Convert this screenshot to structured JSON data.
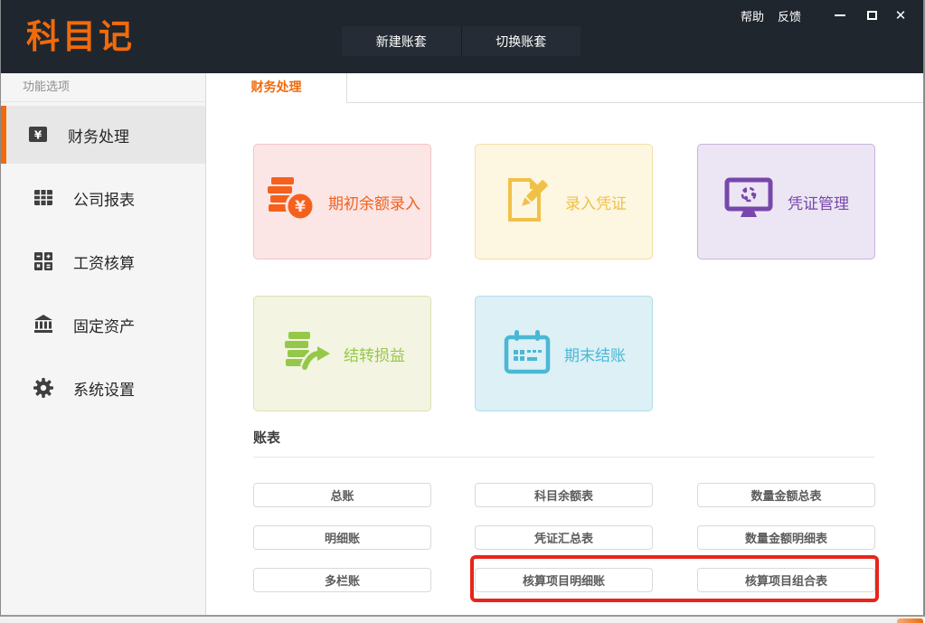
{
  "window": {
    "logo": "科目记",
    "help_label": "帮助",
    "feedback_label": "反馈"
  },
  "header": {
    "new_account_set_label": "新建账套",
    "switch_account_set_label": "切换账套"
  },
  "sidebar": {
    "title": "功能选项",
    "items": [
      {
        "label": "财务处理",
        "icon": "yuan-box-icon",
        "selected": true
      },
      {
        "label": "公司报表",
        "icon": "report-grid-icon",
        "selected": false
      },
      {
        "label": "工资核算",
        "icon": "calculator-icon",
        "selected": false
      },
      {
        "label": "固定资产",
        "icon": "bank-icon",
        "selected": false
      },
      {
        "label": "系统设置",
        "icon": "gear-icon",
        "selected": false
      }
    ]
  },
  "main": {
    "active_tab": "财务处理",
    "cards": [
      {
        "label": "期初余额录入",
        "icon": "coins-yuan-icon",
        "bg": "#fbe5e5",
        "border": "#f5c5c5",
        "accent": "#f4611d"
      },
      {
        "label": "录入凭证",
        "icon": "document-pencil-icon",
        "bg": "#fdf6e1",
        "border": "#f3dfa6",
        "accent": "#f0c149"
      },
      {
        "label": "凭证管理",
        "icon": "monitor-share-icon",
        "bg": "#ece5f3",
        "border": "#c9b3de",
        "accent": "#7747ab"
      },
      {
        "label": "结转损益",
        "icon": "coins-arrow-icon",
        "bg": "#f3f4e1",
        "border": "#dde2b3",
        "accent": "#95c84a"
      },
      {
        "label": "期末结账",
        "icon": "calendar-icon",
        "bg": "#dcf0f6",
        "border": "#b2dcea",
        "accent": "#4ab8d4"
      }
    ],
    "section_title": "账表",
    "table_buttons": [
      [
        "总账",
        "科目余额表",
        "数量金额总表"
      ],
      [
        "明细账",
        "凭证汇总表",
        "数量金额明细表"
      ],
      [
        "多栏账",
        "核算项目明细账",
        "核算项目组合表"
      ]
    ]
  },
  "annotation": {
    "highlight_color": "#e8251c"
  },
  "colors": {
    "brand_orange": "#f26a0a",
    "titlebar_bg": "#20262e",
    "sidebar_bg": "#f5f5f5",
    "selected_item_bg": "#e7e7e7"
  }
}
